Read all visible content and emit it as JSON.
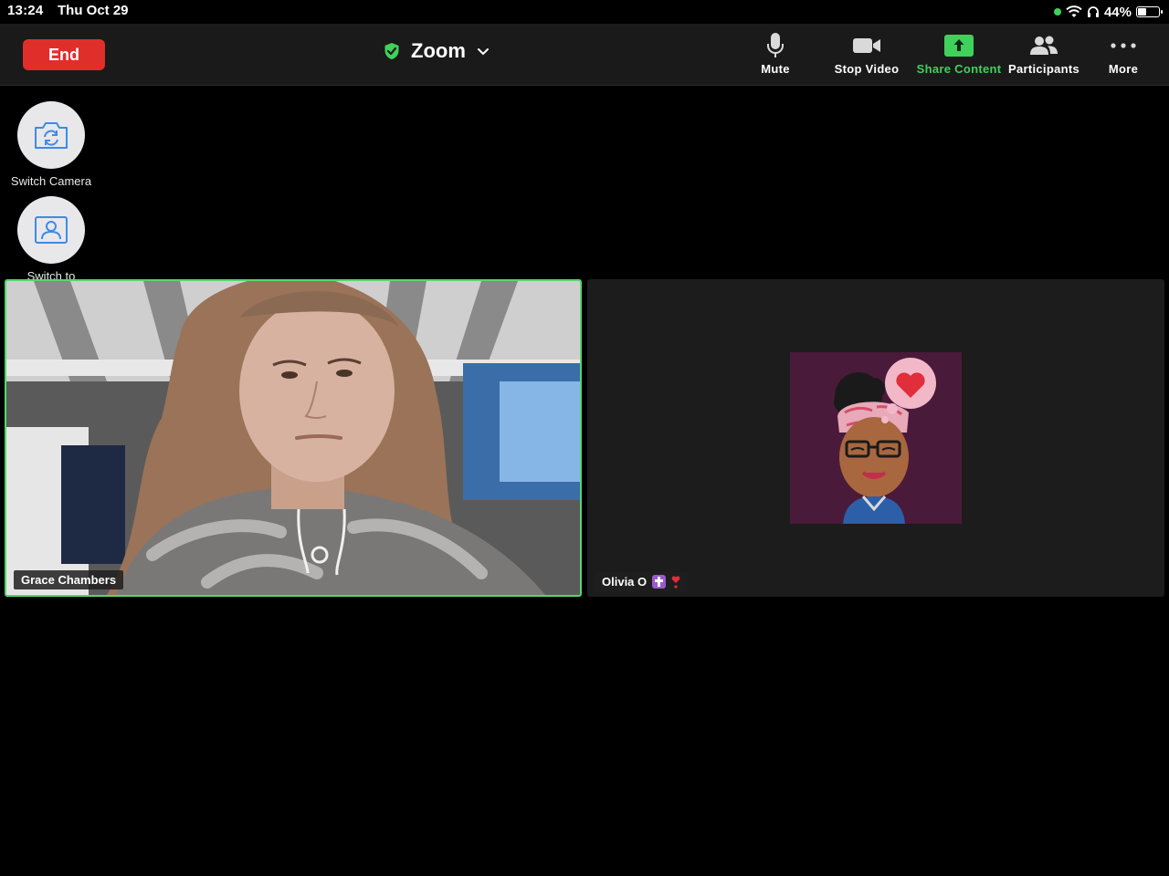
{
  "status_bar": {
    "time": "13:24",
    "date": "Thu Oct 29",
    "battery": "44%",
    "battery_level": 0.44,
    "icons": [
      "camera-in-use-dot-icon",
      "wifi-icon",
      "headphones-icon",
      "battery-icon"
    ]
  },
  "toolbar": {
    "end_label": "End",
    "title": "Zoom",
    "title_icon": "shield-check-icon",
    "items": [
      {
        "label": "Mute",
        "icon": "microphone-icon"
      },
      {
        "label": "Stop Video",
        "icon": "video-camera-icon"
      },
      {
        "label": "Share Content",
        "icon": "share-arrow-icon"
      },
      {
        "label": "Participants",
        "icon": "participants-icon"
      },
      {
        "label": "More",
        "icon": "more-dots-icon"
      }
    ]
  },
  "side_controls": [
    {
      "label": "Switch Camera",
      "icon": "switch-camera-icon"
    },
    {
      "label": "Switch to Active Speaker",
      "icon": "active-speaker-icon"
    }
  ],
  "participants": [
    {
      "name": "Grace Chambers",
      "active": true,
      "video": "camera-feed"
    },
    {
      "name": "Olivia O",
      "active": false,
      "video": "avatar",
      "name_emojis": [
        "cross-emoji",
        "heart-exclamation-emoji"
      ]
    }
  ],
  "colors": {
    "end_button": "#e02e2a",
    "share_green": "#3fd15b",
    "active_border": "#52d86b",
    "toolbar_bg": "#1a1a1a",
    "avatar_bg": "#4a1a3a"
  }
}
